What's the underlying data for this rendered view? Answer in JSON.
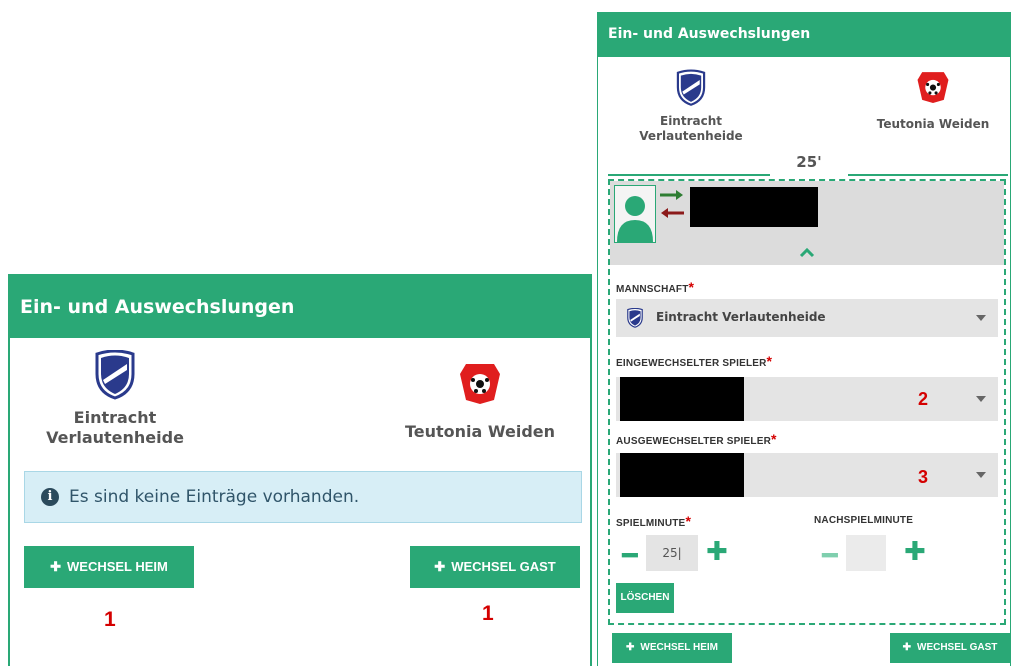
{
  "left": {
    "title": "Ein- und Auswechslungen",
    "home_team_line1": "Eintracht",
    "home_team_line2": "Verlautenheide",
    "away_team": "Teutonia Weiden",
    "info_text": "Es sind keine Einträge vorhanden.",
    "btn_home": "WECHSEL HEIM",
    "btn_away": "WECHSEL GAST",
    "marker_home": "1",
    "marker_away": "1"
  },
  "right": {
    "title": "Ein- und Auswechslungen",
    "home_team_line1": "Eintracht",
    "home_team_line2": "Verlautenheide",
    "away_team": "Teutonia Weiden",
    "minute_display": "25'",
    "label_team": "MANNSCHAFT",
    "team_value": "Eintracht Verlautenheide",
    "label_in": "EINGEWECHSELTER SPIELER",
    "marker_in": "2",
    "label_out": "AUSGEWECHSELTER SPIELER",
    "marker_out": "3",
    "label_minute": "SPIELMINUTE",
    "minute_value": "25|",
    "label_extra": "NACHSPIELMINUTE",
    "extra_value": "",
    "btn_delete": "LÖSCHEN",
    "btn_home": "WECHSEL HEIM",
    "btn_away": "WECHSEL GAST"
  },
  "colors": {
    "accent": "#2aa876",
    "required": "#d40000",
    "marker": "#d40000",
    "arrow_in": "#2e7d32",
    "arrow_out": "#8b1a1a"
  },
  "icons": {
    "info": "info-icon",
    "plus": "plus-icon",
    "minus": "minus-icon",
    "caret": "chevron-down-icon",
    "collapse": "chevron-up-icon",
    "avatar": "player-avatar-icon",
    "home_crest": "eintracht-crest-icon",
    "away_crest": "teutonia-crest-icon"
  }
}
